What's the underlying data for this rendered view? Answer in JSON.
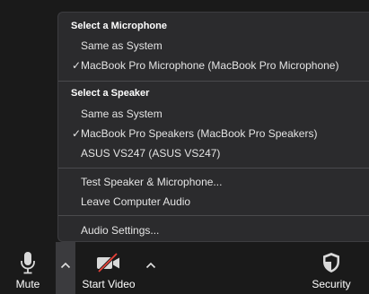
{
  "menu": {
    "microphone_title": "Select a Microphone",
    "microphones": [
      {
        "label": "Same as System",
        "checked": false
      },
      {
        "label": "MacBook Pro Microphone (MacBook Pro Microphone)",
        "checked": true
      }
    ],
    "speaker_title": "Select a Speaker",
    "speakers": [
      {
        "label": "Same as System",
        "checked": false
      },
      {
        "label": "MacBook Pro Speakers (MacBook Pro Speakers)",
        "checked": true
      },
      {
        "label": "ASUS VS247 (ASUS VS247)",
        "checked": false
      }
    ],
    "actions": [
      {
        "label": "Test Speaker & Microphone..."
      },
      {
        "label": "Leave Computer Audio"
      }
    ],
    "settings_label": "Audio Settings...",
    "check_glyph": "✓"
  },
  "toolbar": {
    "mute_label": "Mute",
    "video_label": "Start Video",
    "security_label": "Security",
    "icons": {
      "mute": "microphone-icon",
      "video": "video-off-icon",
      "security": "shield-icon",
      "caret": "chevron-up-icon"
    }
  }
}
